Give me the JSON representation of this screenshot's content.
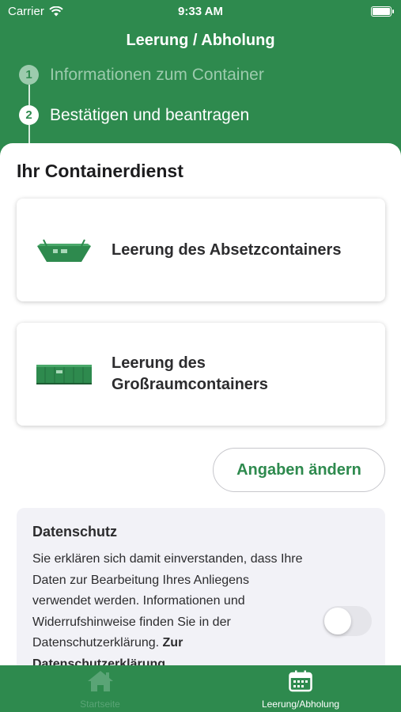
{
  "status_bar": {
    "carrier": "Carrier",
    "time": "9:33 AM"
  },
  "header": {
    "title": "Leerung / Abholung"
  },
  "steps": [
    {
      "number": "1",
      "label": "Informationen zum Container"
    },
    {
      "number": "2",
      "label": "Bestätigen und beantragen"
    }
  ],
  "section_title": "Ihr Containerdienst",
  "cards": [
    {
      "line1": "Leerung des Absetzcontainers",
      "line2": ""
    },
    {
      "line1": "Leerung des",
      "line2": "Großraumcontainers"
    }
  ],
  "change_button": "Angaben ändern",
  "privacy": {
    "title": "Datenschutz",
    "text": "Sie erklären sich damit einverstanden, dass Ihre Daten zur Bearbeitung Ihres Anliegens verwendet werden. Informationen und Widerrufshinweise finden Sie in der Datenschutzerklärung. ",
    "link": "Zur Datenschutzerklärung",
    "toggle_on": false
  },
  "tabs": [
    {
      "label": "Startseite",
      "icon": "home-icon",
      "active": false
    },
    {
      "label": "Leerung/Abholung",
      "icon": "calendar-icon",
      "active": true
    }
  ],
  "colors": {
    "brand_green": "#2e8a4e",
    "step_inactive": "#9ccbad",
    "toggle_off": "#e5e5ea",
    "card_shadow": "rgba(0,0,0,0.22)"
  }
}
